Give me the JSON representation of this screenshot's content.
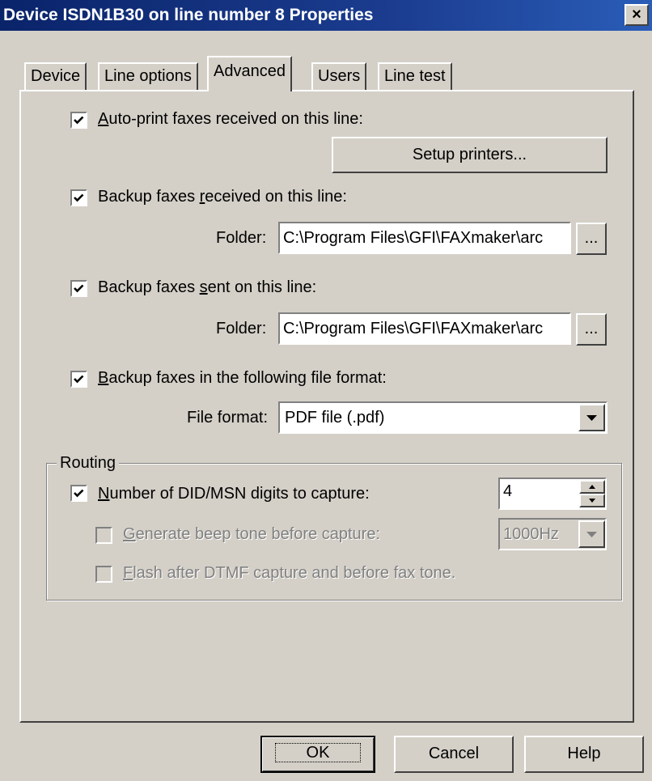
{
  "window": {
    "title": "Device ISDN1B30 on line number 8 Properties",
    "close_label": "×"
  },
  "tabs": [
    {
      "label": "Device"
    },
    {
      "label": "Line options"
    },
    {
      "label": "Advanced"
    },
    {
      "label": "Users"
    },
    {
      "label": "Line test"
    }
  ],
  "advanced": {
    "autoprint": {
      "label_prefix": "",
      "label_u": "A",
      "label_rest": "uto-print faxes received on this line:",
      "checked": true
    },
    "setup_printers_label": "Setup printers...",
    "backup_received": {
      "label_prefix": "Backup faxes ",
      "label_u": "r",
      "label_rest": "eceived on this line:",
      "checked": true
    },
    "folder_label": "Folder:",
    "received_folder_value": "C:\\Program Files\\GFI\\FAXmaker\\arc",
    "browse_label": "...",
    "backup_sent": {
      "label_prefix": "Backup faxes ",
      "label_u": "s",
      "label_rest": "ent on this line:",
      "checked": true
    },
    "sent_folder_value": "C:\\Program Files\\GFI\\FAXmaker\\arc",
    "backup_format": {
      "label_prefix": "",
      "label_u": "B",
      "label_rest": "ackup faxes in the following file format:",
      "checked": true
    },
    "file_format_label": "File format:",
    "file_format_value": "PDF file (.pdf)"
  },
  "routing": {
    "legend": "Routing",
    "did_digits": {
      "label_prefix": "",
      "label_u": "N",
      "label_rest": "umber of DID/MSN digits to capture:",
      "checked": true,
      "value": "4"
    },
    "beep_tone": {
      "label_prefix": "",
      "label_u": "G",
      "label_rest": "enerate beep tone before capture:",
      "checked": false,
      "value": "1000Hz"
    },
    "flash": {
      "label_prefix": "",
      "label_u": "F",
      "label_rest": "lash after DTMF capture and before fax tone.",
      "checked": false
    }
  },
  "footer": {
    "ok_label": "OK",
    "cancel_label": "Cancel",
    "help_label": "Help"
  },
  "icons": {
    "check": "checkmark-icon",
    "dropdown": "chevron-down-icon",
    "spin_up": "spin-up-icon",
    "spin_down": "spin-down-icon"
  }
}
